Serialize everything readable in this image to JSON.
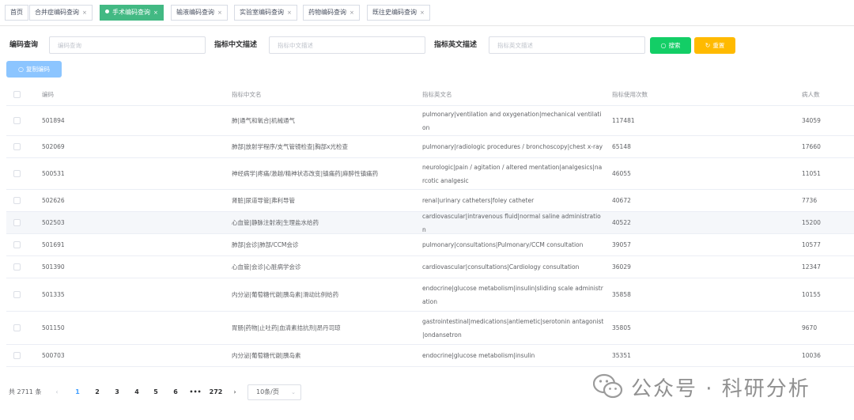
{
  "tabs": [
    {
      "label": "首页",
      "closable": false,
      "active": false
    },
    {
      "label": "合并症编码查询",
      "closable": true,
      "active": false
    },
    {
      "label": "手术编码查询",
      "closable": true,
      "active": true
    },
    {
      "label": "输液编码查询",
      "closable": true,
      "active": false
    },
    {
      "label": "实验室编码查询",
      "closable": true,
      "active": false
    },
    {
      "label": "药物编码查询",
      "closable": true,
      "active": false
    },
    {
      "label": "既往史编码查询",
      "closable": true,
      "active": false
    }
  ],
  "tab_close_glyph": "×",
  "search": {
    "code_label": "编码查询",
    "code_placeholder": "编码查询",
    "cn_label": "指标中文描述",
    "cn_placeholder": "指标中文描述",
    "en_label": "指标英文描述",
    "en_placeholder": "指标英文描述",
    "search_button": "搜索",
    "reset_button": "重置",
    "copy_button": "复制编码"
  },
  "table": {
    "columns": [
      "编码",
      "指标中文名",
      "指标英文名",
      "指标使用次数",
      "病人数"
    ],
    "rows": [
      {
        "code": "501894",
        "cn": "肺|通气和氧合|机械通气",
        "en": "pulmonary|ventilation and oxygenation|mechanical ventilation",
        "count": "117481",
        "patients": "34059"
      },
      {
        "code": "502069",
        "cn": "肺部|放射学程序/支气管镜检查|胸部x光检查",
        "en": "pulmonary|radiologic procedures / bronchoscopy|chest x-ray",
        "count": "65148",
        "patients": "17660"
      },
      {
        "code": "500531",
        "cn": "神经病学|疼痛/激越/精神状态改变|镇痛药|麻醉性镇痛药",
        "en": "neurologic|pain / agitation / altered mentation|analgesics|narcotic analgesic",
        "count": "46055",
        "patients": "11051"
      },
      {
        "code": "502626",
        "cn": "肾脏|尿道导管|弗利导管",
        "en": "renal|urinary catheters|foley catheter",
        "count": "40672",
        "patients": "7736"
      },
      {
        "code": "502503",
        "cn": "心血管|静脉注射液|生理盐水给药",
        "en": "cardiovascular|intravenous fluid|normal saline administration",
        "count": "40522",
        "patients": "15200"
      },
      {
        "code": "501691",
        "cn": "肺部|会诊|肺部/CCM会诊",
        "en": "pulmonary|consultations|Pulmonary/CCM consultation",
        "count": "39057",
        "patients": "10577"
      },
      {
        "code": "501390",
        "cn": "心血管|会诊|心脏病学会诊",
        "en": "cardiovascular|consultations|Cardiology consultation",
        "count": "36029",
        "patients": "12347"
      },
      {
        "code": "501335",
        "cn": "内分泌|葡萄糖代谢|胰岛素|滑动比例给药",
        "en": "endocrine|glucose metabolism|insulin|sliding scale administration",
        "count": "35858",
        "patients": "10155"
      },
      {
        "code": "501150",
        "cn": "胃肠|药物|止吐药|血清素拮抗剂|昂丹司琼",
        "en": "gastrointestinal|medications|antiemetic|serotonin antagonist|ondansetron",
        "count": "35805",
        "patients": "9670"
      },
      {
        "code": "500703",
        "cn": "内分泌|葡萄糖代谢|胰岛素",
        "en": "endocrine|glucose metabolism|insulin",
        "count": "35351",
        "patients": "10036"
      }
    ]
  },
  "pagination": {
    "total_text": "共 2711 条",
    "pages": [
      "1",
      "2",
      "3",
      "4",
      "5",
      "6"
    ],
    "current_page": "1",
    "ellipsis": "•••",
    "last_page": "272",
    "prev": "‹",
    "next": "›",
    "page_size": "10条/页"
  },
  "watermark": {
    "text": "公众号 · 科研分析"
  },
  "colors": {
    "active_tab": "#42b983",
    "search_button": "#13ce66",
    "reset_button": "#ffba00",
    "copy_button": "#8cc5ff",
    "current_page": "#409eff"
  }
}
